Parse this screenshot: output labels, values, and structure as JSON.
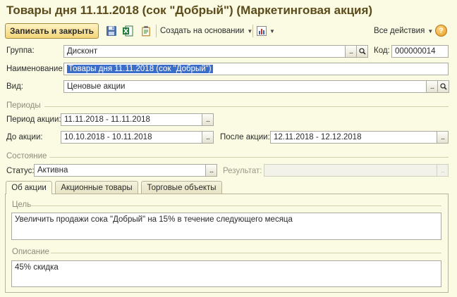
{
  "window": {
    "title": "Товары дня 11.11.2018 (сок \"Добрый\") (Маркетинговая акция)"
  },
  "toolbar": {
    "save_close_label": "Записать и закрыть",
    "create_based_label": "Создать на основании",
    "all_actions_label": "Все действия",
    "help_label": "?"
  },
  "form": {
    "group": {
      "label": "Группа:",
      "value": "Дисконт"
    },
    "code": {
      "label": "Код:",
      "value": "000000014"
    },
    "name": {
      "label": "Наименование:",
      "value": "Товары дня 11.11.2018 (сок \"Добрый\")"
    },
    "kind": {
      "label": "Вид:",
      "value": "Ценовые акции"
    },
    "periods_section": "Периоды",
    "action_period": {
      "label": "Период акции:",
      "value": "11.11.2018 - 11.11.2018"
    },
    "before_action": {
      "label": "До акции:",
      "value": "10.10.2018 - 10.11.2018"
    },
    "after_action": {
      "label": "После акции:",
      "value": "12.11.2018 - 12.12.2018"
    },
    "state_section": "Состояние",
    "status": {
      "label": "Статус:",
      "value": "Активна"
    },
    "result": {
      "label": "Результат:",
      "value": ""
    }
  },
  "tabs": [
    {
      "label": "Об акции",
      "active": true
    },
    {
      "label": "Акционные товары",
      "active": false
    },
    {
      "label": "Торговые объекты",
      "active": false
    }
  ],
  "about": {
    "goal_section": "Цель",
    "goal_text": "Увеличить продажи сока \"Добрый\" на 15% в течение следующего месяца",
    "description_section": "Описание",
    "description_text": "45% скидка"
  },
  "icons": {
    "save": "floppy-disk-icon",
    "excel": "excel-icon",
    "clipboard": "clipboard-icon",
    "report": "bar-chart-icon",
    "select": "ellipsis-icon",
    "open": "magnifier-icon",
    "help": "question-icon"
  },
  "colors": {
    "title": "#5b4a1a",
    "accent_button": "#f3d57a",
    "background": "#fbfbe4",
    "selection": "#3b6ec9"
  }
}
